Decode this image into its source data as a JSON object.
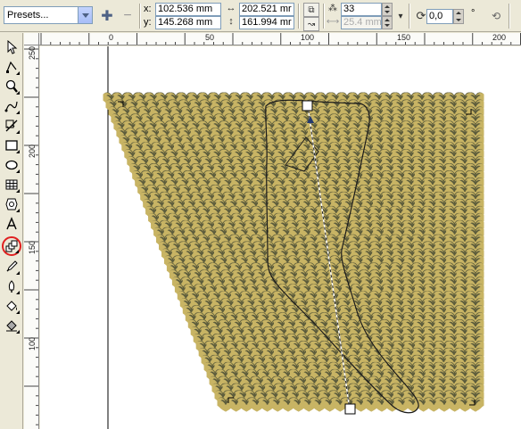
{
  "propbar": {
    "presets_label": "Presets...",
    "x_label": "x:",
    "y_label": "y:",
    "x_value": "102.536 mm",
    "y_value": "145.268 mm",
    "width_value": "202.521 mr",
    "height_value": "161.994 mr",
    "steps_value": "33",
    "spacing_value": "25.4 mm",
    "rotation_value": "0,0",
    "degree_symbol": "°"
  },
  "rulers": {
    "horizontal": [
      "0",
      "50",
      "100",
      "150",
      "200"
    ],
    "vertical": [
      "250",
      "200",
      "150",
      "100"
    ]
  },
  "tools": [
    {
      "name": "pick-tool"
    },
    {
      "name": "shape-tool"
    },
    {
      "name": "zoom-tool"
    },
    {
      "name": "freehand-tool"
    },
    {
      "name": "smart-fill-tool"
    },
    {
      "name": "rectangle-tool"
    },
    {
      "name": "ellipse-tool"
    },
    {
      "name": "polygon-tool"
    },
    {
      "name": "basic-shapes-tool"
    },
    {
      "name": "text-tool"
    },
    {
      "name": "blend-tool"
    },
    {
      "name": "eyedropper-tool"
    },
    {
      "name": "outline-tool"
    },
    {
      "name": "fill-tool"
    },
    {
      "name": "interactive-fill-tool"
    }
  ],
  "colors": {
    "heart_fill": "#c8b464",
    "heart_shadow": "#5c5c3c",
    "highlight_circle": "#e02020",
    "blend_control": "#243a6e"
  }
}
